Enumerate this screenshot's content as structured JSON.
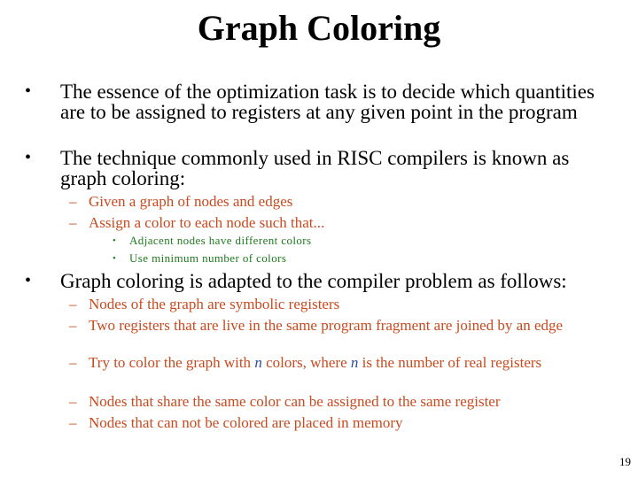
{
  "title": "Graph Coloring",
  "bullets": [
    "The essence of the optimization task is to decide which quantities are to be assigned to registers at any given point in the program",
    "The technique commonly used in RISC compilers is known as graph coloring:",
    "Graph coloring is adapted to the compiler problem as follows:"
  ],
  "bullet2_sub": [
    "Given a graph of nodes and edges",
    "Assign a color to each node such that..."
  ],
  "bullet2_subsub": [
    "Adjacent nodes have different colors",
    "Use minimum number of colors"
  ],
  "bullet3_sub": [
    "Nodes of the graph are symbolic registers",
    "Two registers that are live in the same program fragment are joined by an edge",
    {
      "part1": "Try to color the graph with ",
      "var1": "n",
      "part2": " colors, where ",
      "var2": "n",
      "part3": " is the number of real registers"
    },
    "Nodes that share the same color can be assigned to the same register",
    "Nodes that can not be colored are placed in memory"
  ],
  "markers": {
    "bullet": "•",
    "dash": "–",
    "subbullet": "•"
  },
  "colors": {
    "level1": "#000000",
    "level2": "#C84A1E",
    "level3": "#1E7A1E",
    "variable": "#2E4E9A"
  },
  "page_number": "19"
}
